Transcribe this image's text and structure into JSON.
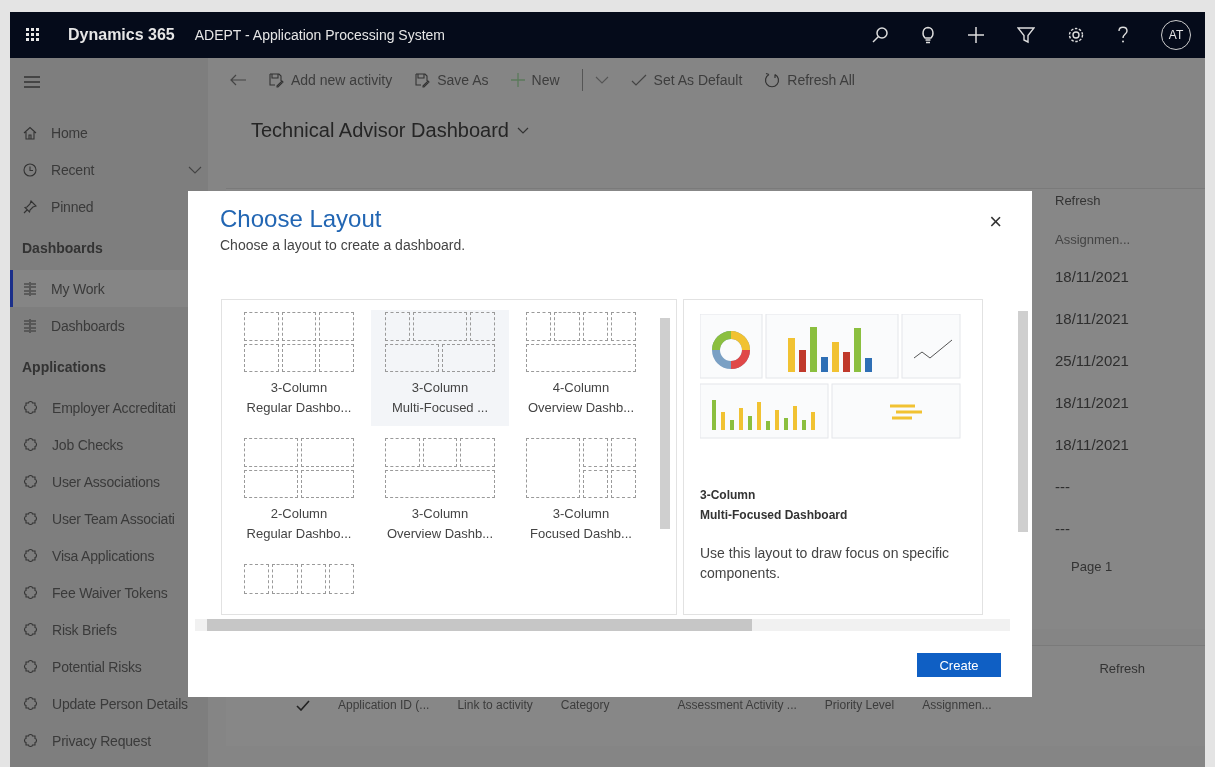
{
  "top_bar": {
    "brand": "Dynamics 365",
    "app_name": "ADEPT - Application Processing System",
    "icons": [
      {
        "kind": "search"
      },
      {
        "kind": "lightbulb"
      },
      {
        "kind": "plus"
      },
      {
        "kind": "filter"
      },
      {
        "kind": "settings"
      },
      {
        "kind": "help"
      }
    ],
    "avatar": "AT"
  },
  "toolbar": {
    "items": [
      {
        "kind": "back"
      },
      {
        "kind": "activity",
        "label": "Add new activity"
      },
      {
        "kind": "save",
        "label": "Save As"
      },
      {
        "kind": "new",
        "label": "New"
      },
      {
        "kind": "split"
      },
      {
        "kind": "check",
        "label": "Set As Default"
      },
      {
        "kind": "refresh",
        "label": "Refresh All"
      }
    ]
  },
  "page_title": "Technical Advisor Dashboard",
  "sidebar": {
    "nav": [
      {
        "kind": "home",
        "label": "Home"
      },
      {
        "kind": "recent",
        "label": "Recent"
      },
      {
        "kind": "pin",
        "label": "Pinned"
      }
    ],
    "groups": [
      {
        "title": "Dashboards",
        "items": [
          {
            "kind": "dashboard",
            "label": "My Work",
            "selected": true
          },
          {
            "kind": "dashboard",
            "label": "Dashboards",
            "selected": false
          }
        ]
      },
      {
        "title": "Applications",
        "items": [
          {
            "kind": "entity",
            "label": "Employer Accreditati",
            "selected": false
          },
          {
            "kind": "entity",
            "label": "Job Checks",
            "selected": false
          },
          {
            "kind": "entity",
            "label": "User Associations",
            "selected": false
          },
          {
            "kind": "entity",
            "label": "User Team Associati",
            "selected": false
          },
          {
            "kind": "entity",
            "label": "Visa Applications",
            "selected": false
          },
          {
            "kind": "entity",
            "label": "Fee Waiver Tokens",
            "selected": false
          },
          {
            "kind": "entity",
            "label": "Risk Briefs",
            "selected": false
          },
          {
            "kind": "entity",
            "label": "Potential Risks",
            "selected": false
          },
          {
            "kind": "entity",
            "label": "Update Person Details",
            "selected": false
          },
          {
            "kind": "entity",
            "label": "Privacy Request",
            "selected": false
          }
        ]
      }
    ]
  },
  "upper_panel": {
    "action": "Refresh",
    "column": "Assignmen...",
    "cells": [
      "18/11/2021",
      "18/11/2021",
      "25/11/2021",
      "18/11/2021",
      "18/11/2021",
      "---",
      "---"
    ],
    "pager": "Page 1"
  },
  "lower_panel": {
    "action": "Refresh",
    "columns": [
      "Application ID (...",
      "Link to activity",
      "Category",
      "Assessment Activity ...",
      "Priority Level",
      "Assignmen..."
    ]
  },
  "dialog": {
    "title": "Choose Layout",
    "subtitle": "Choose a layout to create a dashboard.",
    "close": "×",
    "layouts": [
      {
        "kind": "regular3",
        "lines": [
          "3-Column",
          "Regular Dashbo..."
        ],
        "selected": false
      },
      {
        "kind": "multi3",
        "lines": [
          "3-Column",
          "Multi-Focused ..."
        ],
        "selected": true
      },
      {
        "kind": "overview4",
        "lines": [
          "4-Column",
          "Overview Dashb..."
        ],
        "selected": false
      },
      {
        "kind": "regular2",
        "lines": [
          "2-Column",
          "Regular Dashbo..."
        ],
        "selected": false
      },
      {
        "kind": "overview3",
        "lines": [
          "3-Column",
          "Overview Dashb..."
        ],
        "selected": false
      },
      {
        "kind": "focused3",
        "lines": [
          "3-Column",
          "Focused Dashb..."
        ],
        "selected": false
      },
      {
        "kind": "regular4",
        "selected": false
      }
    ],
    "preview": {
      "title_lines": [
        "3-Column",
        "Multi-Focused Dashboard"
      ],
      "description": "Use this layout to draw focus on specific components."
    },
    "create_button": "Create"
  }
}
